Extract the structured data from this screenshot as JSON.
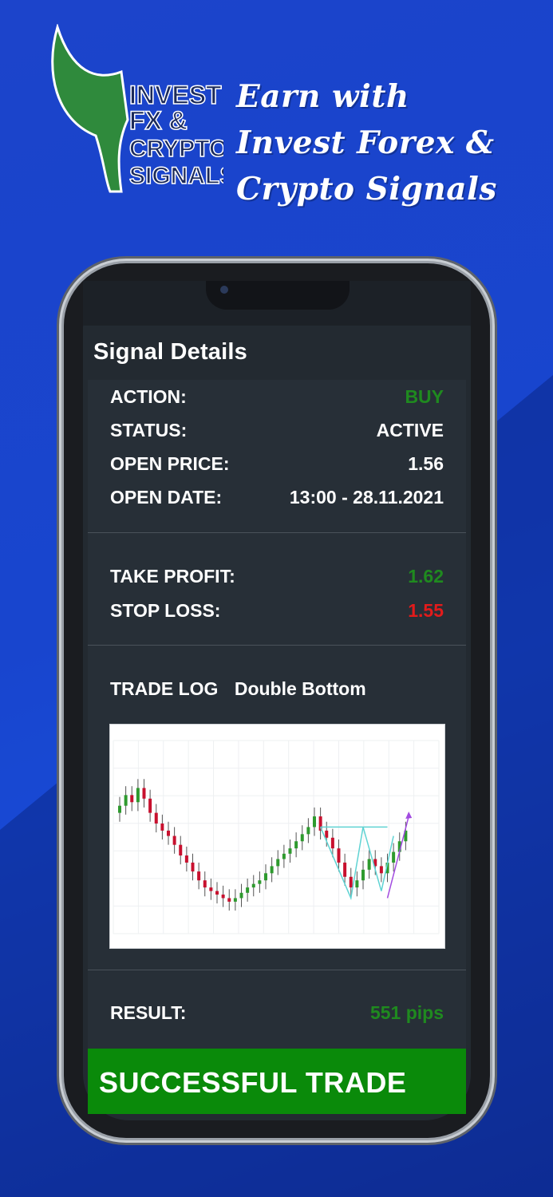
{
  "header": {
    "headline_lines": [
      "Earn with",
      "Invest Forex &",
      "Crypto Signals"
    ],
    "logo_lines": [
      "INVEST",
      "FX &",
      "CRYPTO",
      "SIGNALS"
    ]
  },
  "screen": {
    "title": "Signal Details",
    "details": [
      {
        "label": "ACTION:",
        "value": "BUY",
        "color": "#1f8a1f"
      },
      {
        "label": "STATUS:",
        "value": "ACTIVE",
        "color": "#ffffff"
      },
      {
        "label": "OPEN PRICE:",
        "value": "1.56",
        "color": "#ffffff"
      },
      {
        "label": "OPEN DATE:",
        "value": "13:00 - 28.11.2021",
        "color": "#ffffff"
      }
    ],
    "targets": [
      {
        "label": "TAKE PROFIT:",
        "value": "1.62",
        "color": "#1f8a1f"
      },
      {
        "label": "STOP LOSS:",
        "value": "1.55",
        "color": "#e21b1b"
      }
    ],
    "trade_log": {
      "label": "TRADE LOG",
      "pattern": "Double Bottom"
    },
    "result": {
      "label": "RESULT:",
      "value": "551 pips"
    },
    "banner": "SUCCESSFUL TRADE"
  },
  "chart_data": {
    "type": "candlestick",
    "pattern": "Double Bottom",
    "candle_closes_relative": [
      0.72,
      0.78,
      0.74,
      0.82,
      0.76,
      0.68,
      0.62,
      0.58,
      0.55,
      0.5,
      0.44,
      0.4,
      0.35,
      0.3,
      0.26,
      0.24,
      0.22,
      0.2,
      0.18,
      0.2,
      0.23,
      0.26,
      0.28,
      0.3,
      0.34,
      0.38,
      0.42,
      0.45,
      0.48,
      0.52,
      0.56,
      0.6,
      0.66,
      0.58,
      0.54,
      0.48,
      0.4,
      0.32,
      0.26,
      0.3,
      0.36,
      0.42,
      0.38,
      0.34,
      0.4,
      0.46,
      0.52,
      0.58
    ],
    "colors": {
      "up": "#2e9a2e",
      "down": "#c8102e",
      "neckline": "#5fd3d3",
      "arrow": "#a24be0"
    }
  }
}
